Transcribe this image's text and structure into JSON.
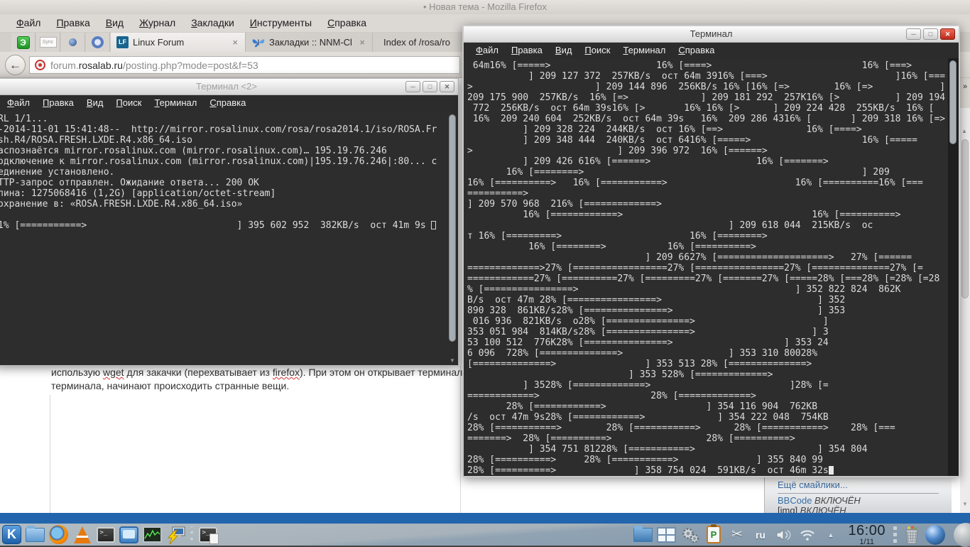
{
  "glyphs": {
    "back": "←",
    "overflow": "»",
    "tab_close": "×",
    "win_min": "─",
    "win_max": "□",
    "win_close": "✕",
    "kmenu": "K",
    "terminal_prompt": ">_",
    "klipper": "P",
    "scissors": "✂",
    "expander": "▲",
    "scroll_up": "▲",
    "scroll_down": "▼"
  },
  "colors": {
    "close_button": "#bb2b18",
    "terminal_bg": "#2d2d2d",
    "page_bluebar": "#2365ac",
    "taskbar_top": "#b2bcc3"
  },
  "firefox": {
    "title": "• Новая тема - Mozilla Firefox",
    "menu": [
      "Файл",
      "Правка",
      "Вид",
      "Журнал",
      "Закладки",
      "Инструменты",
      "Справка"
    ],
    "pinned": [
      "Э",
      "Sync"
    ],
    "tabs": [
      {
        "label": "Linux Forum"
      },
      {
        "label": "Закладки :: NNM-Club"
      },
      {
        "label": "Index of /rosa/ro"
      }
    ],
    "favicon_lf": "LF",
    "url": {
      "prefix": "forum.",
      "domain": "rosalab.ru",
      "path": "/posting.php?mode=post&f=53"
    },
    "page": {
      "body1_a": "использую ",
      "body1_b": "wget",
      "body1_c": " для закачки (перехватывает из ",
      "body1_d": "firefox",
      "body1_e": "). При этом он открывает терминал для",
      "body2": "терминала, начинают происходить странные вещи.",
      "sidebar_link": "Ещё смайлики...",
      "bbcode_label": "BBCode",
      "bbcode_state": "ВКЛЮЧЁН",
      "img_label": "[img]",
      "img_state": "ВКЛЮЧЁН"
    }
  },
  "terminal_left": {
    "title": "Терминал <2>",
    "menu": [
      "Файл",
      "Правка",
      "Вид",
      "Поиск",
      "Терминал",
      "Справка"
    ],
    "cursor": {
      "line": 10,
      "style": "hollow"
    },
    "lines": [
      "RL 1/1...",
      "-2014-11-01 15:41:48--  http://mirror.rosalinux.com/rosa/rosa2014.1/iso/ROSA.Fr",
      "sh.R4/ROSA.FRESH.LXDE.R4.x86_64.iso",
      "аспознаётся mirror.rosalinux.com (mirror.rosalinux.com)… 195.19.76.246",
      "одключение к mirror.rosalinux.com (mirror.rosalinux.com)|195.19.76.246|:80... с",
      "единение установлено.",
      "TTP-запрос отправлен. Ожидание ответа... 200 OK",
      "лина: 1275068416 (1,2G) [application/octet-stream]",
      "охранение в: «ROSA.FRESH.LXDE.R4.x86_64.iso»",
      "",
      "1% [===========>                           ] 395 602 952  382KB/s  ост 41m 9s "
    ]
  },
  "terminal_right": {
    "title": "Терминал",
    "menu": [
      "Файл",
      "Правка",
      "Вид",
      "Поиск",
      "Терминал",
      "Справка"
    ],
    "cursor": {
      "line": 38,
      "style": "block"
    },
    "lines": [
      " 64m16% [=====>                   16% [====>                           16% [===>",
      "           ] 209 127 372  257KB/s  ост 64m 3916% [===>                       ]16% [===",
      ">                      ] 209 144 896  256KB/s 16% [16% [=>        16% [=>            ]",
      "209 175 900  257KB/s  16% [=>             ] 209 181 292  257K16% [>          ] 209 194",
      " 772  256KB/s  ост 64m 39s16% [>       16% 16% [>      ] 209 224 428  255KB/s  16% [",
      " 16%  209 240 604  252KB/s  ост 64m 39s   16%  209 286 4316% [       ] 209 318 16% [=>",
      "          ] 209 328 224  244KB/s  ост 16% [==>               16% [====>",
      "          ] 209 348 444  240KB/s  ост 6416% [=====>                    16% [=====",
      ">                          ] 209 396 972  16% [======>",
      "          ] 209 426 616% [======>                   16% [=======>",
      "       16% [========>                                                  ] 209",
      "16% [==========>   16% [===========>                       16% [==========16% [===",
      "==========>",
      "] 209 570 968  216% [=============>",
      "          16% [============>                                  16% [==========>",
      "                                               ] 209 618 044  215KB/s  ос",
      "т 16% [=========>                       16% [========>",
      "           16% [========>           16% [==========>",
      "                                ] 209 6627% [====================>   27% [======",
      "=============>27% [=================27% [================27% [==============27% [=",
      "============27% [==========27% [=========27% [=======27% [=====28% [===28% [=28% [=28",
      "% [================>                                       ] 352 822 824  862K",
      "B/s  ост 47m 28% [================>                            ] 352",
      "890 328  861KB/s28% [===============>                          ] 353",
      " 016 936  821KB/s  o28% [===============>                       ]",
      "353 051 984  814KB/s28% [===============>                     ] 3",
      "53 100 512  776K28% [===============>                    ] 353 24",
      "6 096  728% [==============>                   ] 353 310 80028%",
      "[==============>                ] 353 513 28% [==============>",
      "                             ] 353 528% [=============>",
      "          ] 3528% [=============>                         ]28% [=",
      "============>                    28% [=============>",
      "       28% [============>                  ] 354 116 904  762KB",
      "/s  ост 47m 9s28% [============>             ] 354 222 048  754KB",
      "28% [===========>        28% [===========>      28% [===========>    28% [===",
      "=======>  28% [==========>                 28% [==========>",
      "           ] 354 751 81228% [===========>                      ] 354 804",
      "28% [==========>     28% [===========>              ] 355 840 99",
      "28% [==========>              ] 358 754 024  591KB/s  ост 46m 32s"
    ]
  },
  "taskbar": {
    "keyboard_layout": "ru",
    "clock_time": "16:00",
    "clock_date": "1/11",
    "launcher_icons": [
      "kmenu",
      "file-manager",
      "firefox",
      "vlc",
      "terminal",
      "display",
      "system-monitor",
      "remote-desktop",
      "terminal-session"
    ],
    "tray_icons": [
      "downloads-folder",
      "pager",
      "system-settings",
      "klipper",
      "scissors",
      "keyboard-layout",
      "volume",
      "wifi",
      "tray-expander",
      "clock",
      "trash",
      "updater-sphere"
    ]
  }
}
